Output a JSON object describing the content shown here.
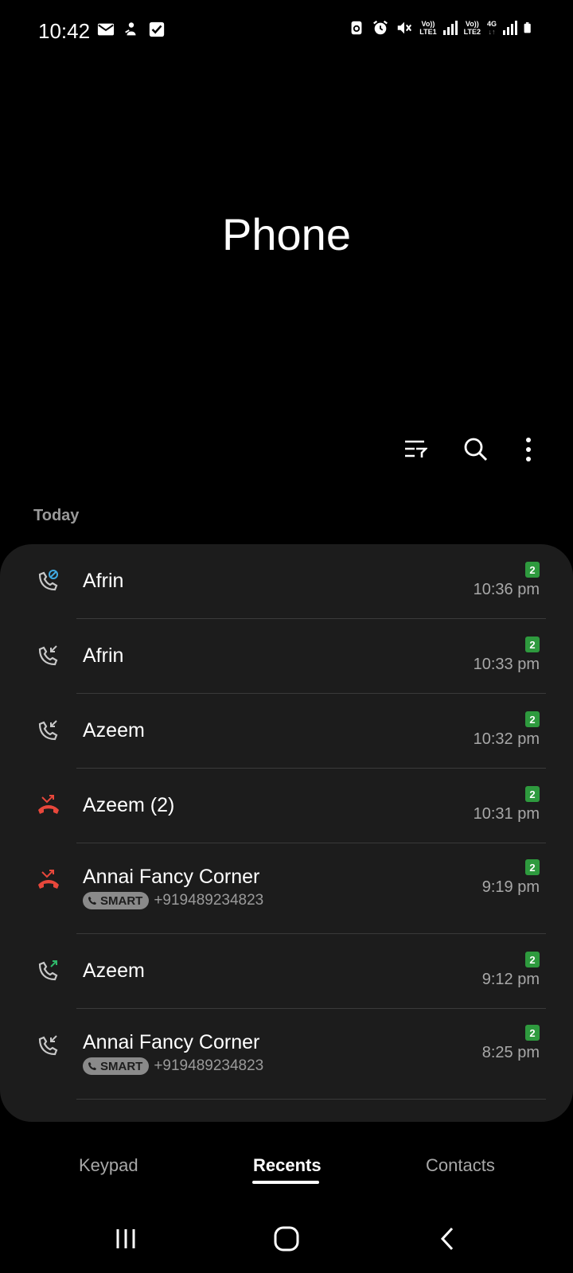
{
  "status_bar": {
    "time": "10:42",
    "left_icons": [
      "mail-icon",
      "person-icon",
      "checkbox-icon"
    ],
    "right_icons": [
      "screenshot-icon",
      "alarm-icon",
      "mute-icon"
    ],
    "sim1_label": "Vo))",
    "sim1_sub": "LTE1",
    "sim2_label": "Vo))",
    "sim2_sub": "LTE2",
    "net_label": "4G",
    "net_sub": "↓↑"
  },
  "title": "Phone",
  "toolbar": {
    "filter_icon": "filter-icon",
    "search_icon": "search-icon",
    "more_icon": "more-options-icon"
  },
  "section_label": "Today",
  "calls": [
    {
      "name": "Afrin",
      "sim": "2",
      "time": "10:36 pm",
      "type": "blocked",
      "icon": "blocked-call-icon"
    },
    {
      "name": "Afrin",
      "sim": "2",
      "time": "10:33 pm",
      "type": "incoming",
      "icon": "incoming-call-icon"
    },
    {
      "name": "Azeem",
      "sim": "2",
      "time": "10:32 pm",
      "type": "incoming",
      "icon": "incoming-call-icon"
    },
    {
      "name": "Azeem (2)",
      "sim": "2",
      "time": "10:31 pm",
      "type": "missed",
      "icon": "missed-call-icon"
    },
    {
      "name": "Annai Fancy Corner",
      "sim": "2",
      "time": "9:19 pm",
      "type": "missed",
      "icon": "missed-call-icon",
      "badge": "SMART",
      "number": "+919489234823"
    },
    {
      "name": "Azeem",
      "sim": "2",
      "time": "9:12 pm",
      "type": "outgoing",
      "icon": "outgoing-call-icon"
    },
    {
      "name": "Annai Fancy Corner",
      "sim": "2",
      "time": "8:25 pm",
      "type": "incoming",
      "icon": "incoming-call-icon",
      "badge": "SMART",
      "number": "+919489234823"
    }
  ],
  "tabs": [
    {
      "label": "Keypad",
      "active": false
    },
    {
      "label": "Recents",
      "active": true
    },
    {
      "label": "Contacts",
      "active": false
    }
  ],
  "nav": {
    "recents": "recent-apps-icon",
    "home": "home-icon",
    "back": "back-icon"
  },
  "colors": {
    "background": "#000000",
    "card": "#1c1c1c",
    "missed": "#e8473b",
    "outgoing": "#2fb86a",
    "blocked": "#3fa8e0",
    "sim_badge": "#2e9a3e"
  }
}
